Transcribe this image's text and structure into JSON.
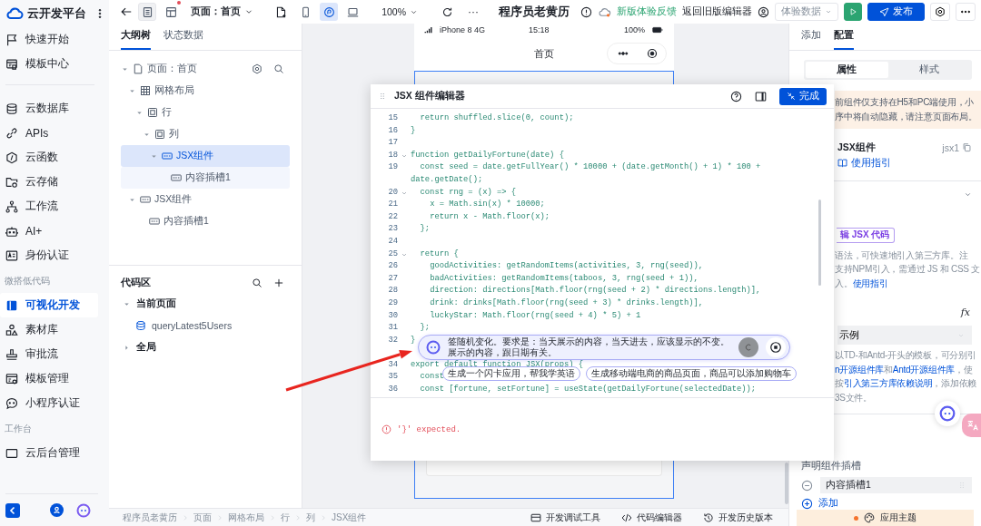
{
  "sidebar": {
    "brand": "云开发平台",
    "sections": [
      {
        "items": [
          {
            "label": "快速开始",
            "selected": false
          },
          {
            "label": "模板中心",
            "selected": false
          }
        ]
      },
      {
        "items": [
          {
            "label": "云数据库",
            "selected": false
          },
          {
            "label": "APIs",
            "selected": false
          },
          {
            "label": "云函数",
            "selected": false
          },
          {
            "label": "云存储",
            "selected": false
          },
          {
            "label": "工作流",
            "selected": false
          },
          {
            "label": "AI+",
            "selected": false
          },
          {
            "label": "身份认证",
            "selected": false
          }
        ]
      },
      {
        "title": "微搭低代码",
        "items": [
          {
            "label": "可视化开发",
            "selected": true
          },
          {
            "label": "素材库",
            "selected": false
          },
          {
            "label": "审批流",
            "selected": false
          },
          {
            "label": "模板管理",
            "selected": false
          },
          {
            "label": "小程序认证",
            "selected": false
          }
        ]
      },
      {
        "title": "工作台",
        "items": [
          {
            "label": "云后台管理",
            "selected": false
          }
        ]
      }
    ]
  },
  "toolbar": {
    "views": [
      {
        "selected": true,
        "dot": false
      },
      {
        "selected": false,
        "dot": true
      }
    ],
    "page_select": "页面：首页",
    "devices": [
      {
        "selected": false
      },
      {
        "selected": true
      },
      {
        "selected": false
      }
    ],
    "zoom": "100%",
    "more": "···",
    "app_title": "程序员老黄历",
    "cloud_dot": true,
    "feedback": "新版体验反馈",
    "legacy": "返回旧版编辑器",
    "data_select": "体验数据",
    "publish": "发布"
  },
  "outline": {
    "tabs": [
      {
        "label": "大纲树",
        "selected": true
      },
      {
        "label": "状态数据",
        "selected": false
      }
    ],
    "nodes": [
      {
        "label": "页面：首页",
        "kind": "page",
        "expanded": true,
        "selected": false,
        "children": [
          {
            "label": "网格布局",
            "kind": "grid",
            "expanded": true,
            "selected": false,
            "children": [
              {
                "label": "行",
                "kind": "container",
                "expanded": true,
                "selected": false,
                "children": [
                  {
                    "label": "列",
                    "kind": "container",
                    "expanded": true,
                    "selected": false,
                    "children": [
                      {
                        "label": "JSX组件",
                        "kind": "jsx",
                        "expanded": true,
                        "selected": true,
                        "children": [
                          {
                            "label": "内容插槽1",
                            "kind": "jsx",
                            "selected": false
                          }
                        ]
                      }
                    ]
                  }
                ]
              }
            ]
          },
          {
            "label": "JSX组件",
            "kind": "jsx",
            "expanded": true,
            "selected": false,
            "children": [
              {
                "label": "内容插槽1",
                "kind": "jsx",
                "selected": false
              }
            ]
          }
        ]
      }
    ]
  },
  "code_area": {
    "title": "代码区",
    "groups": [
      {
        "label": "当前页面",
        "expanded": true,
        "items": [
          "queryLatest5Users"
        ]
      },
      {
        "label": "全局",
        "expanded": false
      }
    ]
  },
  "phone": {
    "carrier": "iPhone 8  4G",
    "time": "15:18",
    "battery": "100%",
    "page_title": "首页"
  },
  "editor": {
    "title": "JSX 组件编辑器",
    "done": "完成",
    "lines": [
      {
        "num": "15",
        "code": "  return shuffled.slice(0, count);",
        "fold": false
      },
      {
        "num": "16",
        "code": "}",
        "fold": false
      },
      {
        "num": "17",
        "fold": false
      },
      {
        "num": "18",
        "code": "function getDailyFortune(date) {",
        "fold": true
      },
      {
        "num": "19",
        "code": "  const seed = date.getFullYear() * 10000 + (date.getMonth() + 1) * 100 + date.getDate();",
        "fold": false
      },
      {
        "num": "20",
        "code": "  const rng = (x) => {",
        "fold": true
      },
      {
        "num": "21",
        "code": "    x = Math.sin(x) * 10000;",
        "fold": false
      },
      {
        "num": "22",
        "code": "    return x - Math.floor(x);",
        "fold": false
      },
      {
        "num": "23",
        "code": "  };",
        "fold": false
      },
      {
        "num": "24",
        "fold": false
      },
      {
        "num": "25",
        "code": "  return {",
        "fold": true
      },
      {
        "num": "26",
        "code": "    goodActivities: getRandomItems(activities, 3, rng(seed)),",
        "fold": false
      },
      {
        "num": "27",
        "code": "    badActivities: getRandomItems(taboos, 3, rng(seed + 1)),",
        "fold": false
      },
      {
        "num": "28",
        "code": "    direction: directions[Math.floor(rng(seed + 2) * directions.length)],",
        "fold": false
      },
      {
        "num": "29",
        "code": "    drink: drinks[Math.floor(rng(seed + 3) * drinks.length)],",
        "fold": false
      },
      {
        "num": "30",
        "code": "    luckyStar: Math.floor(rng(seed + 4) * 5) + 1",
        "fold": false
      },
      {
        "num": "31",
        "code": "  };",
        "fold": false
      },
      {
        "num": "32",
        "code": "}",
        "fold": false
      }
    ],
    "lines_after": [
      {
        "num": "34",
        "code": "export default function JSX(props) {",
        "fold": false
      },
      {
        "num": "35",
        "code": "  const",
        "fold": false
      },
      {
        "num": "36",
        "code": "  const [fortune, setFortune] = useState(getDailyFortune(selectedDate));",
        "fold": false
      }
    ],
    "ai_prompt": "签随机变化。要求是：当天展示的内容，当天进去，应该显示的不变。展示的内容，跟日期有关。",
    "suggestions": [
      "生成一个闪卡应用，帮我学英语",
      "生成移动端电商的商品页面，商品可以添加购物车"
    ],
    "error": "'}' expected."
  },
  "config": {
    "tabs": [
      {
        "label": "添加",
        "selected": false
      },
      {
        "label": "配置",
        "selected": true
      }
    ],
    "segments": [
      {
        "label": "属性",
        "selected": true
      },
      {
        "label": "样式",
        "selected": false
      }
    ],
    "notice": [
      "前组件仅支持在H5和PC端使用，小",
      "序中将自动隐藏，请注意页面布局。"
    ],
    "component": {
      "name": "JSX组件",
      "id": "jsx1",
      "guide": "使用指引"
    },
    "edit_button": "辑 JSX 代码",
    "description": [
      [
        {
          "text": "语法，可快速地引入第三方库。注"
        }
      ],
      [
        {
          "text": "支持NPM引入，需通过 JS 和 CSS 文"
        }
      ],
      [
        {
          "text": "入。"
        },
        {
          "text": "使用指引",
          "link": true
        }
      ]
    ],
    "formula": "fx",
    "example_select": "示例",
    "example_note": [
      [
        {
          "text": "以TD-和Antd-开头的模板，可分别引"
        }
      ],
      [
        {
          "text": "n开源组件库",
          "link": true
        },
        {
          "text": "和"
        },
        {
          "text": "Antd开源组件库",
          "link": true
        },
        {
          "text": "，使"
        }
      ],
      [
        {
          "text": "按"
        },
        {
          "text": "引入第三方库依赖说明",
          "link": true
        },
        {
          "text": "，添加依赖"
        }
      ],
      [
        {
          "text": "3S文件。"
        }
      ]
    ],
    "slots_title": "声明组件插槽",
    "slots": [
      "内容插槽1"
    ],
    "add": "添加",
    "theme": "应用主题"
  },
  "status_bar": {
    "breadcrumbs": [
      "程序员老黄历",
      "页面",
      "网格布局",
      "行",
      "列",
      "JSX组件"
    ],
    "tools": [
      "开发调试工具",
      "代码编辑器",
      "开发历史版本"
    ]
  }
}
